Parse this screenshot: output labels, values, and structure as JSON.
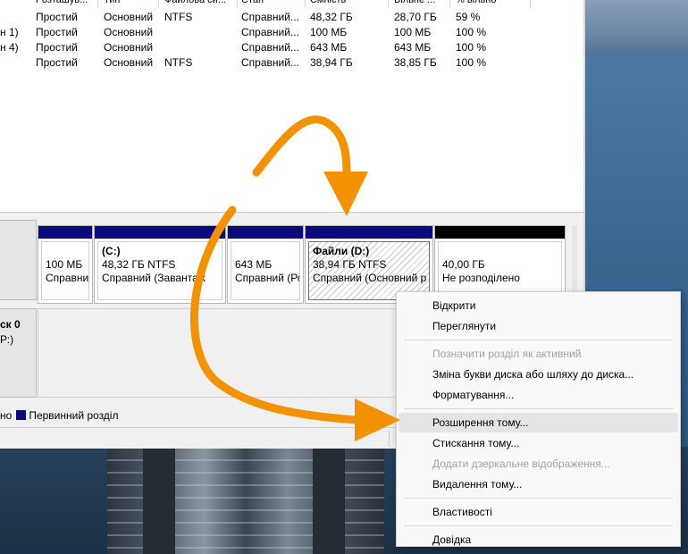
{
  "columns": [
    "Розташув...",
    "Тип",
    "Файлова си...",
    "Стан",
    "Ємність",
    "Вільне ...",
    "% вільно"
  ],
  "volumes": [
    {
      "name": "",
      "layout": "Простий",
      "type": "Основний",
      "fs": "NTFS",
      "status": "Справний...",
      "capacity": "48,32 ГБ",
      "free": "28,70 ГБ",
      "pct": "59 %"
    },
    {
      "name": "н 1)",
      "layout": "Простий",
      "type": "Основний",
      "fs": "",
      "status": "Справний...",
      "capacity": "100 МБ",
      "free": "100 МБ",
      "pct": "100 %"
    },
    {
      "name": "н 4)",
      "layout": "Простий",
      "type": "Основний",
      "fs": "",
      "status": "Справний...",
      "capacity": "643 МБ",
      "free": "643 МБ",
      "pct": "100 %"
    },
    {
      "name": "",
      "layout": "Простий",
      "type": "Основний",
      "fs": "NTFS",
      "status": "Справний...",
      "capacity": "38,94 ГБ",
      "free": "38,85 ГБ",
      "pct": "100 %"
    }
  ],
  "disk": {
    "label1": "ск 0",
    "label2": "Р:)",
    "partitions": [
      {
        "title": "",
        "size": "100 МБ",
        "status": "Справни"
      },
      {
        "title": "(C:)",
        "size": "48,32 ГБ NTFS",
        "status": "Справний (Завантаж"
      },
      {
        "title": "",
        "size": "643 МБ",
        "status": "Справний (Ро"
      },
      {
        "title": "Файли  (D:)",
        "size": "38,94 ГБ NTFS",
        "status": "Справний (Основний р"
      },
      {
        "title": "",
        "size": "40,00 ГБ",
        "status": "Не розподілено"
      }
    ]
  },
  "legend": {
    "prefix": "но",
    "primary": "Первинний розділ"
  },
  "context_menu": [
    {
      "label": "Відкрити",
      "enabled": true
    },
    {
      "label": "Переглянути",
      "enabled": true
    },
    {
      "label": "Позначити розділ як активний",
      "enabled": false
    },
    {
      "label": "Зміна букви диска або шляху до диска...",
      "enabled": true
    },
    {
      "label": "Форматування...",
      "enabled": true
    },
    {
      "label": "Розширення тому...",
      "enabled": true,
      "highlighted": true
    },
    {
      "label": "Стискання тому...",
      "enabled": true
    },
    {
      "label": "Додати дзеркальне відображення...",
      "enabled": false
    },
    {
      "label": "Видалення тому...",
      "enabled": true
    },
    {
      "label": "Властивості",
      "enabled": true
    },
    {
      "label": "Довідка",
      "enabled": true
    }
  ],
  "colors": {
    "primary_partition": "#0a0a7a",
    "unallocated": "#000000",
    "arrow": "#f39200"
  }
}
